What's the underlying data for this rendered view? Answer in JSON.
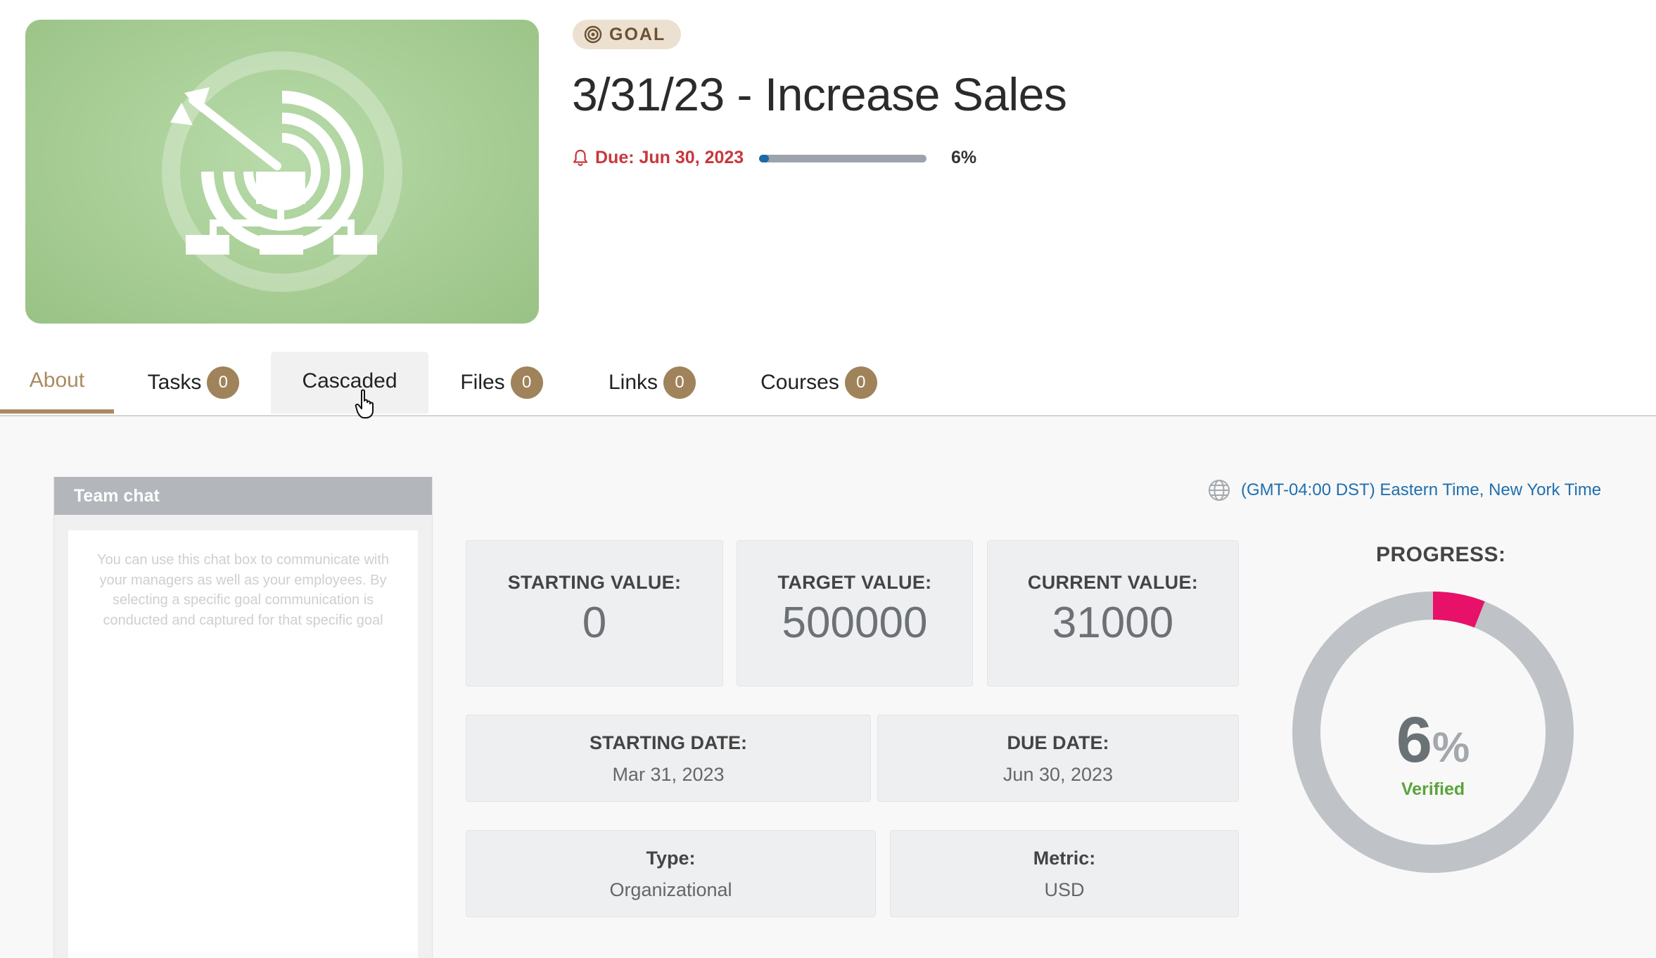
{
  "header": {
    "chip_label": "GOAL",
    "title": "3/31/23 - Increase Sales",
    "due_text": "Due: Jun 30, 2023",
    "progress_fraction": 0.06,
    "progress_label": "6%"
  },
  "tabs": [
    {
      "label": "About",
      "badge": null
    },
    {
      "label": "Tasks",
      "badge": "0"
    },
    {
      "label": "Cascaded",
      "badge": null
    },
    {
      "label": "Files",
      "badge": "0"
    },
    {
      "label": "Links",
      "badge": "0"
    },
    {
      "label": "Courses",
      "badge": "0"
    }
  ],
  "team_chat": {
    "title": "Team chat",
    "hint": "You can use this chat box to communicate with your managers as well as your employees. By selecting a specific goal communication is conducted and captured for that specific goal"
  },
  "timezone": "(GMT-04:00 DST) Eastern Time, New York Time",
  "stats": {
    "starting_label": "STARTING VALUE:",
    "starting_value": "0",
    "target_label": "TARGET VALUE:",
    "target_value": "500000",
    "current_label": "CURRENT VALUE:",
    "current_value": "31000",
    "starting_date_label": "STARTING DATE:",
    "starting_date": "Mar 31, 2023",
    "due_date_label": "DUE DATE:",
    "due_date": "Jun 30, 2023",
    "type_label": "Type:",
    "type_value": "Organizational",
    "metric_label": "Metric:",
    "metric_value": "USD"
  },
  "progress": {
    "title": "PROGRESS:",
    "number": "6",
    "percent_sign": "%",
    "status": "Verified",
    "fraction": 0.06
  },
  "colors": {
    "accent": "#a98b62",
    "badge": "#a0835a",
    "due_red": "#c8373d",
    "link_blue": "#1f6fae",
    "donut_fill": "#e8116a",
    "donut_track": "#bfc3c7",
    "verified_green": "#5aa43a"
  },
  "icons": {
    "chip": "target-icon",
    "due": "bell-icon",
    "timezone": "globe-icon",
    "hero": "target-arrow-org-chart-icon",
    "cursor": "hand-pointer-cursor"
  }
}
